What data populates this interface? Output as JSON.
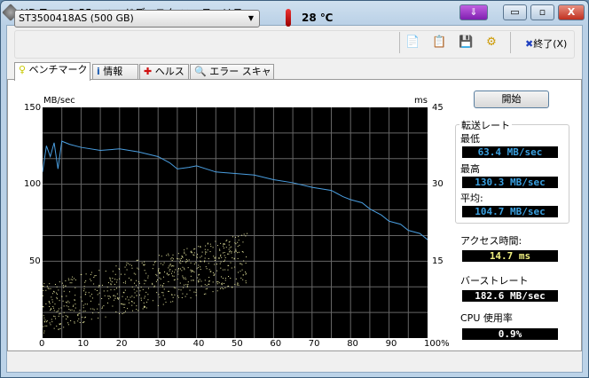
{
  "window": {
    "title": "HD Tune 2.55 - ハードディスク ユーティリティ",
    "buttons": {
      "minimize": "▭",
      "maximize": "▫",
      "close": "X",
      "download": "⇓"
    }
  },
  "toolbar": {
    "drive": "ST3500418AS (500 GB)",
    "temperature": "28 ℃",
    "exit_label": "終了(X)",
    "icons": [
      "copy-text-icon",
      "copy-screenshot-icon",
      "save-icon",
      "options-icon",
      "exit-icon"
    ]
  },
  "tabs": [
    {
      "label": "ベンチマーク",
      "icon": "bulb-icon"
    },
    {
      "label": "情報",
      "icon": "info-icon"
    },
    {
      "label": "ヘルス",
      "icon": "health-cross-icon"
    },
    {
      "label": "エラー スキャン",
      "icon": "magnifier-icon"
    }
  ],
  "side": {
    "start": "開始",
    "transfer_group": "転送レート",
    "min_label": "最低",
    "min": "63.4 MB/sec",
    "max_label": "最高",
    "max": "130.3 MB/sec",
    "avg_label": "平均:",
    "avg": "104.7 MB/sec",
    "access_label": "アクセス時間:",
    "access": "14.7 ms",
    "burst_label": "バーストレート",
    "burst": "182.6 MB/sec",
    "cpu_label": "CPU 使用率",
    "cpu": "0.9%"
  },
  "colors": {
    "transfer": "#4a9ee0",
    "access": "#e8e8a0",
    "value_blue": "#3aa0e0",
    "value_yellow": "#f0f080",
    "value_white": "#ffffff"
  },
  "chart_data": {
    "type": "line+scatter",
    "left_unit": "MB/sec",
    "right_unit": "ms",
    "left_ylim": [
      0,
      150
    ],
    "right_ylim": [
      0,
      45
    ],
    "left_ticks": [
      "150",
      "100",
      "50"
    ],
    "right_ticks": [
      "45",
      "30",
      "15"
    ],
    "xlim": [
      0,
      100
    ],
    "x_ticks": [
      "0",
      "10",
      "20",
      "30",
      "40",
      "50",
      "60",
      "70",
      "80",
      "90",
      "100%"
    ],
    "grid": true,
    "transfer_series": {
      "x": [
        0,
        1,
        2,
        3,
        4,
        5,
        7,
        10,
        15,
        20,
        25,
        30,
        33,
        35,
        38,
        40,
        45,
        50,
        55,
        60,
        65,
        70,
        75,
        78,
        80,
        83,
        85,
        88,
        90,
        93,
        95,
        98,
        100
      ],
      "y": [
        108,
        125,
        118,
        127,
        110,
        128,
        126,
        124,
        122,
        123,
        121,
        118,
        114,
        110,
        111,
        112,
        108,
        107,
        106,
        103,
        101,
        98,
        96,
        92,
        90,
        88,
        84,
        80,
        76,
        74,
        70,
        68,
        64
      ]
    },
    "access_scatter": {
      "x_range": [
        0,
        53
      ],
      "y_range_ms": [
        6,
        21
      ]
    }
  }
}
